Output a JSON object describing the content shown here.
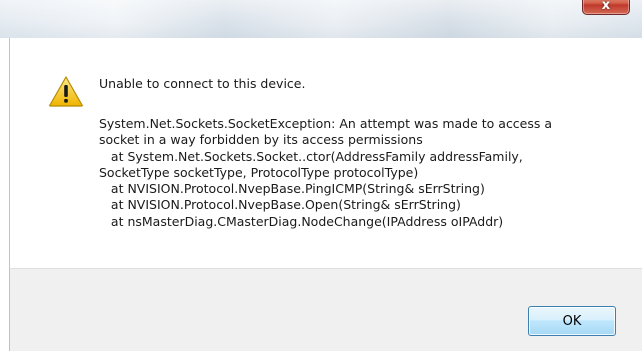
{
  "window": {
    "close_glyph": "x"
  },
  "dialog": {
    "icon": "warning-icon",
    "title_message": "Unable to connect to this device.",
    "details": "System.Net.Sockets.SocketException: An attempt was made to access a\nsocket in a way forbidden by its access permissions\n   at System.Net.Sockets.Socket..ctor(AddressFamily addressFamily,\nSocketType socketType, ProtocolType protocolType)\n   at NVISION.Protocol.NvepBase.PingICMP(String& sErrString)\n   at NVISION.Protocol.NvepBase.Open(String& sErrString)\n   at nsMasterDiag.CMasterDiag.NodeChange(IPAddress oIPAddr)"
  },
  "buttons": {
    "ok_label": "OK"
  },
  "colors": {
    "warning_fill": "#f4c430",
    "accent_border": "#3c7fb1"
  }
}
